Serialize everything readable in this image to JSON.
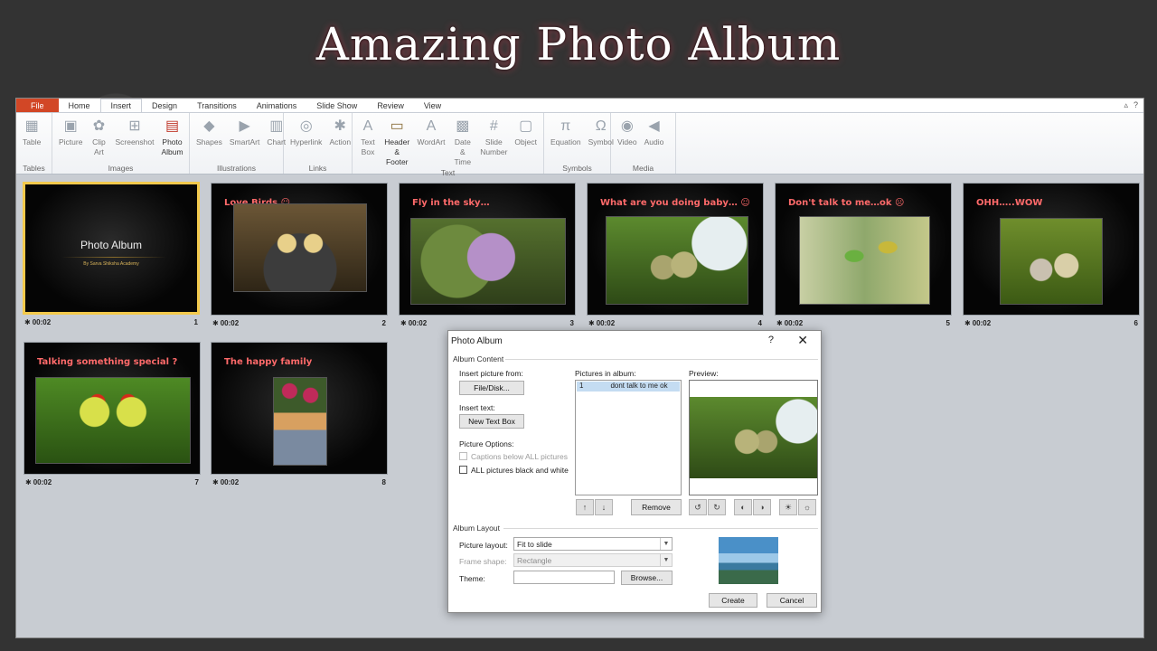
{
  "slide": {
    "title": "Amazing Photo Album"
  },
  "ribbon": {
    "tabs": [
      "File",
      "Home",
      "Insert",
      "Design",
      "Transitions",
      "Animations",
      "Slide Show",
      "Review",
      "View"
    ],
    "active_tab": "Insert",
    "groups": [
      {
        "label": "Tables",
        "items": [
          {
            "name": "Table",
            "sub": ""
          }
        ]
      },
      {
        "label": "Images",
        "items": [
          {
            "name": "Picture",
            "sub": ""
          },
          {
            "name": "Clip",
            "sub": "Art"
          },
          {
            "name": "Screenshot",
            "sub": ""
          },
          {
            "name": "Photo",
            "sub": "Album"
          }
        ]
      },
      {
        "label": "Illustrations",
        "items": [
          {
            "name": "Shapes",
            "sub": ""
          },
          {
            "name": "SmartArt",
            "sub": ""
          },
          {
            "name": "Chart",
            "sub": ""
          }
        ]
      },
      {
        "label": "Links",
        "items": [
          {
            "name": "Hyperlink",
            "sub": ""
          },
          {
            "name": "Action",
            "sub": ""
          }
        ]
      },
      {
        "label": "Text",
        "items": [
          {
            "name": "Text",
            "sub": "Box"
          },
          {
            "name": "Header",
            "sub": "& Footer"
          },
          {
            "name": "WordArt",
            "sub": ""
          },
          {
            "name": "Date &",
            "sub": "Time"
          },
          {
            "name": "Slide",
            "sub": "Number"
          },
          {
            "name": "Object",
            "sub": ""
          }
        ]
      },
      {
        "label": "Symbols",
        "items": [
          {
            "name": "Equation",
            "sub": ""
          },
          {
            "name": "Symbol",
            "sub": ""
          }
        ]
      },
      {
        "label": "Media",
        "items": [
          {
            "name": "Video",
            "sub": ""
          },
          {
            "name": "Audio",
            "sub": ""
          }
        ]
      }
    ]
  },
  "slides": [
    {
      "num": "1",
      "time": "00:02",
      "caption": "",
      "title": "Photo Album",
      "subtitle": "By Sarva Shiksha Academy"
    },
    {
      "num": "2",
      "time": "00:02",
      "caption": "Love Birds ☺"
    },
    {
      "num": "3",
      "time": "00:02",
      "caption": "Fly in the sky…"
    },
    {
      "num": "4",
      "time": "00:02",
      "caption": "What are you doing baby… ☺"
    },
    {
      "num": "5",
      "time": "00:02",
      "caption": "Don't talk to me…ok ☹"
    },
    {
      "num": "6",
      "time": "00:02",
      "caption": "OHH…..WOW"
    },
    {
      "num": "7",
      "time": "00:02",
      "caption": "Talking something special ?"
    },
    {
      "num": "8",
      "time": "00:02",
      "caption": "The happy family"
    }
  ],
  "dialog": {
    "title": "Photo Album",
    "help": "?",
    "close": "✕",
    "album_content": "Album Content",
    "insert_picture_from": "Insert picture from:",
    "file_disk": "File/Disk...",
    "insert_text": "Insert text:",
    "new_text_box": "New Text Box",
    "picture_options": "Picture Options:",
    "captions_below": "Captions below ALL pictures",
    "all_bw": "ALL pictures black and white",
    "pictures_in_album": "Pictures in album:",
    "album_items": [
      {
        "index": "1",
        "name": "dont talk to me ok"
      }
    ],
    "preview": "Preview:",
    "remove": "Remove",
    "album_layout": "Album Layout",
    "picture_layout_label": "Picture layout:",
    "picture_layout_value": "Fit to slide",
    "frame_shape_label": "Frame shape:",
    "frame_shape_value": "Rectangle",
    "theme_label": "Theme:",
    "theme_value": "",
    "browse": "Browse...",
    "create": "Create",
    "cancel": "Cancel"
  },
  "colors": {
    "file_tab": "#d24726",
    "caption": "#ff6a6a",
    "selected_border": "#f3c94c",
    "list_selection": "#c4dcf2"
  }
}
